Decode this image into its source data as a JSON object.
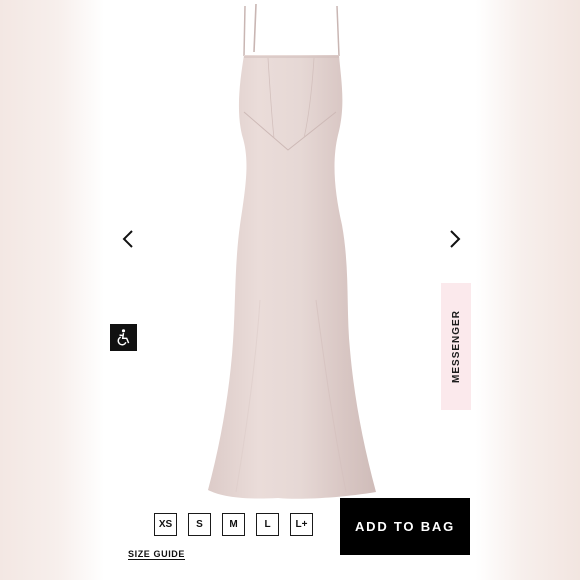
{
  "colors": {
    "dress": "#e4d5d2",
    "messenger_bg": "#fbe9ec",
    "button_bg": "#000000"
  },
  "carousel": {
    "prev_icon": "chevron-left-icon",
    "next_icon": "chevron-right-icon"
  },
  "accessibility": {
    "icon": "wheelchair-icon"
  },
  "messenger": {
    "label": "MESSENGER"
  },
  "sizes": [
    "XS",
    "S",
    "M",
    "L",
    "L+"
  ],
  "size_guide": {
    "label": "SIZE GUIDE"
  },
  "cart": {
    "add_label": "ADD TO BAG"
  }
}
